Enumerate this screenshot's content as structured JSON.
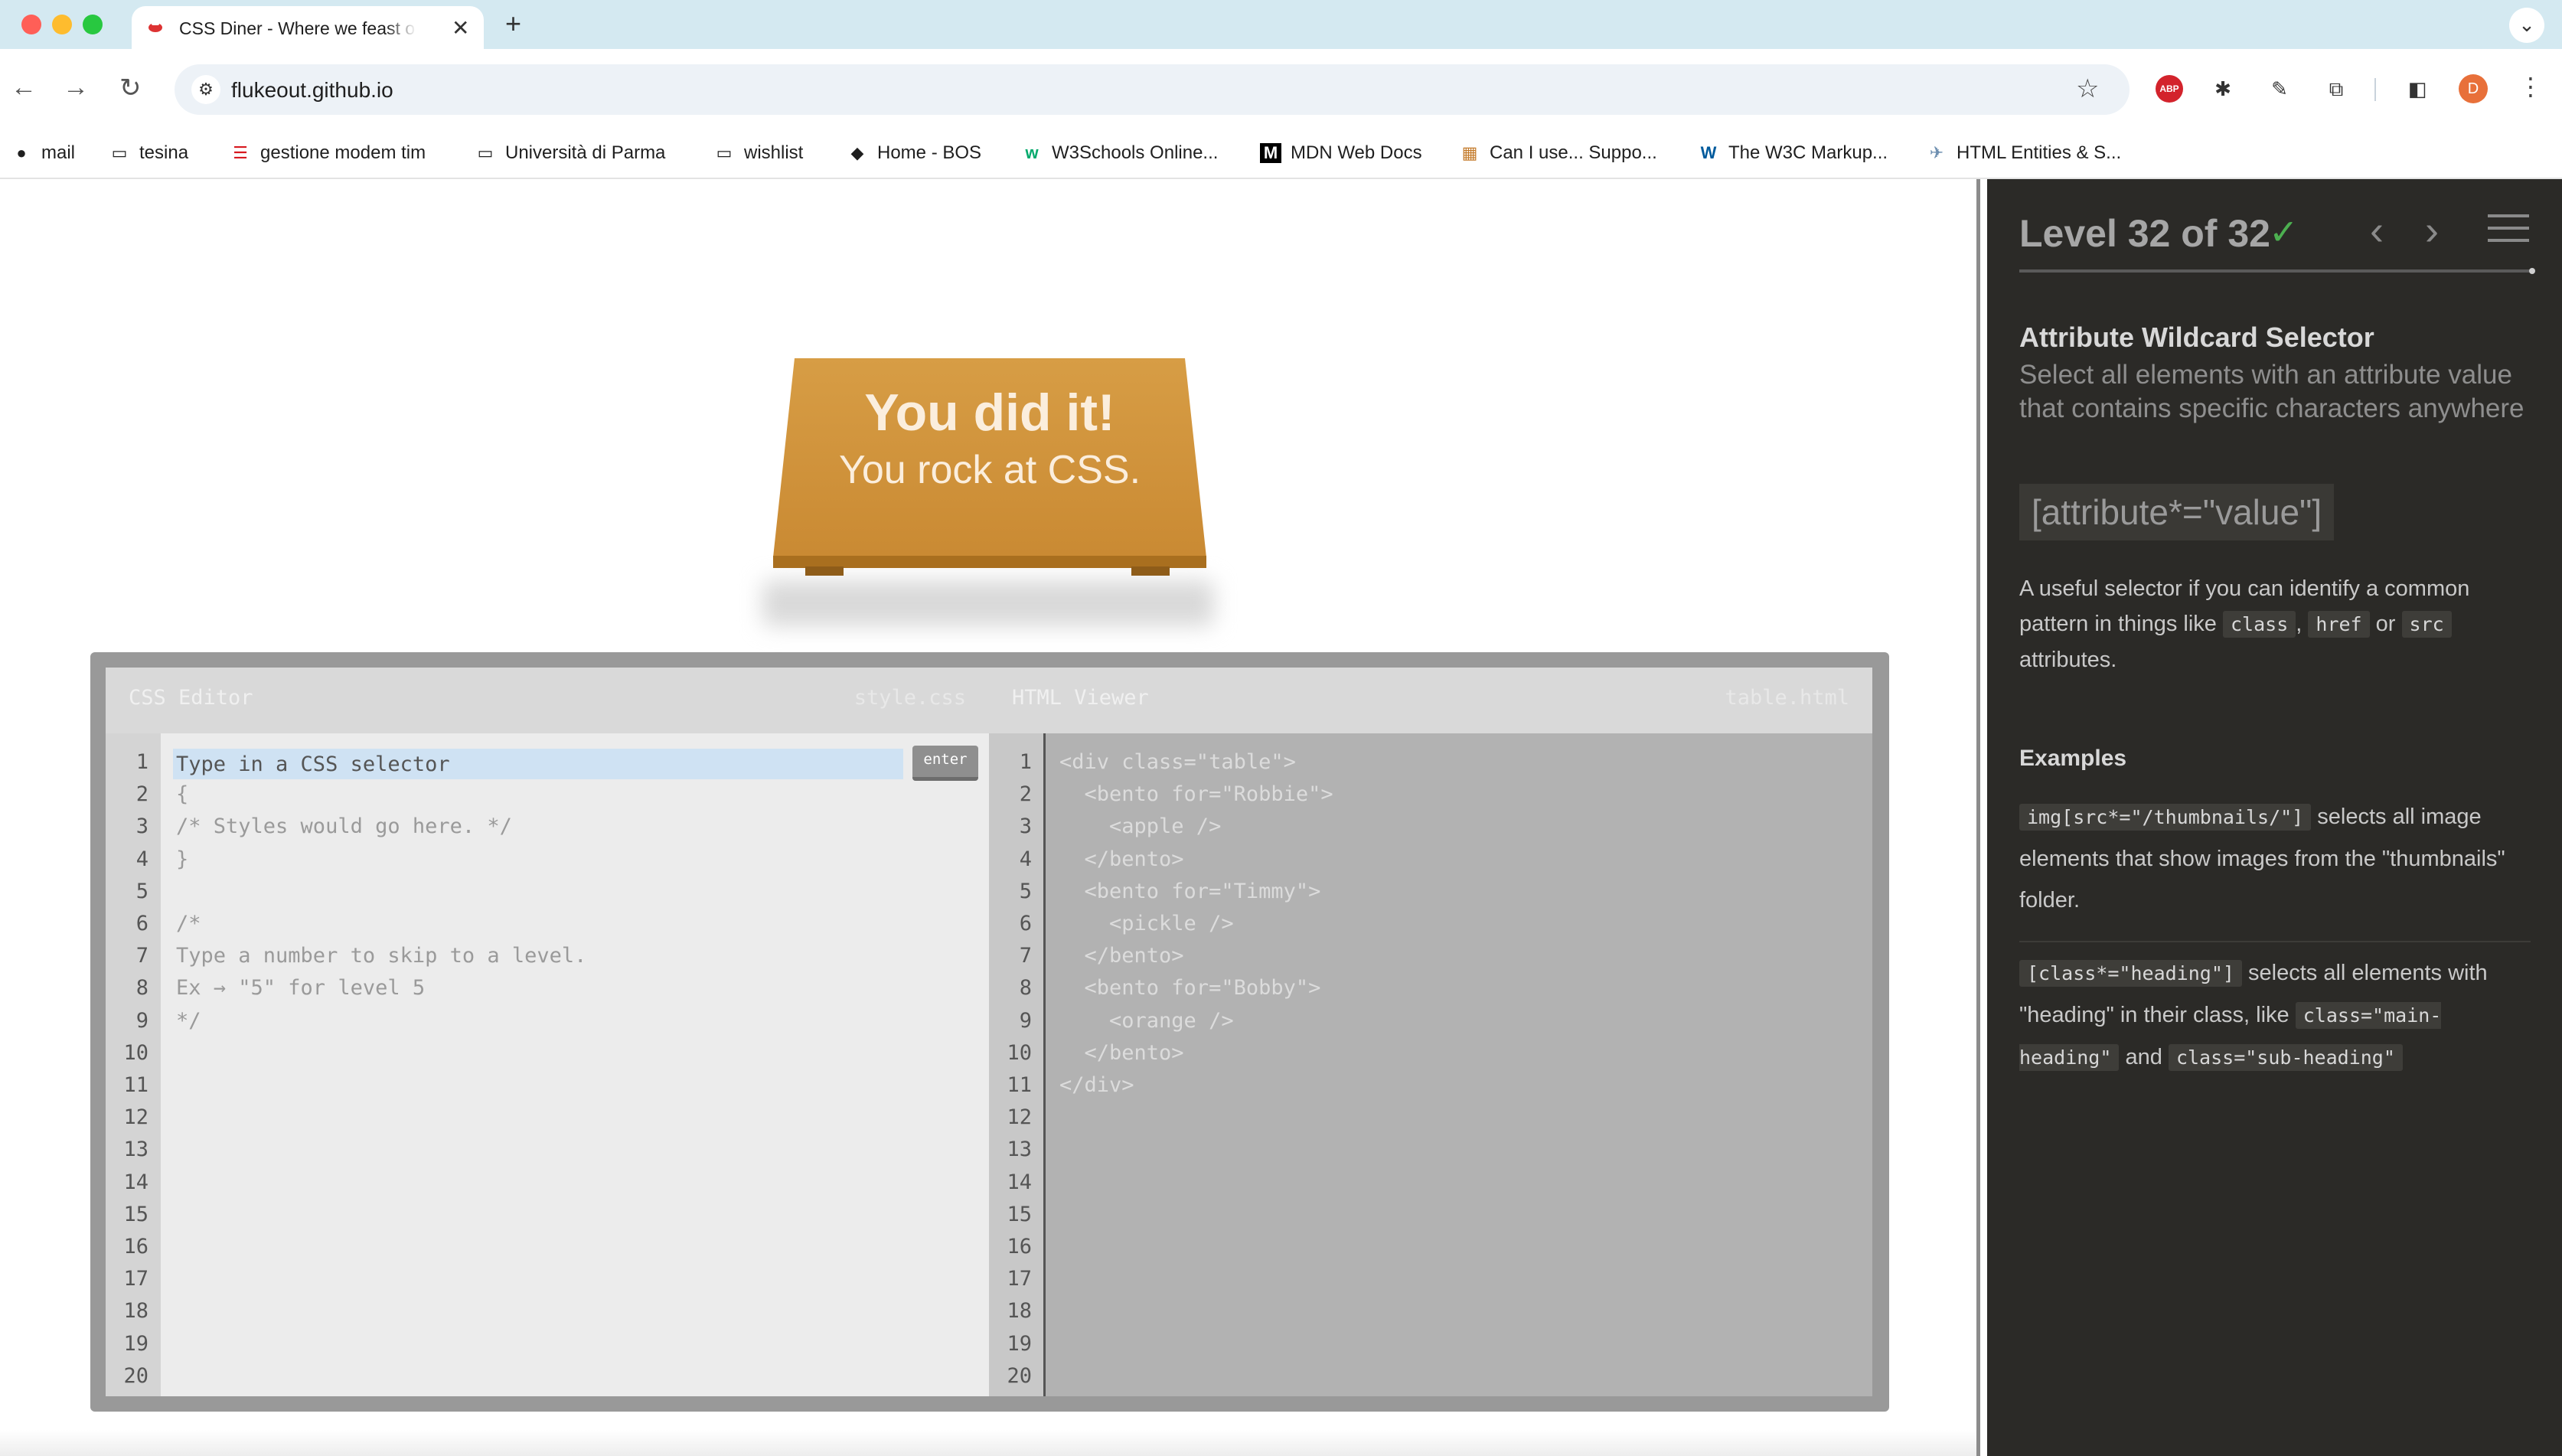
{
  "browser": {
    "tab_title": "CSS Diner - Where we feast on CSS",
    "url": "flukeout.github.io",
    "bookmarks": [
      {
        "label": "mail",
        "icon": "apple-icon"
      },
      {
        "label": "tesina",
        "icon": "folder-icon"
      },
      {
        "label": "gestione modem tim",
        "icon": "tim-icon"
      },
      {
        "label": "Università di Parma",
        "icon": "folder-icon"
      },
      {
        "label": "wishlist",
        "icon": "folder-icon"
      },
      {
        "label": "Home - BOS",
        "icon": "bos-icon"
      },
      {
        "label": "W3Schools Online...",
        "icon": "w3schools-icon"
      },
      {
        "label": "MDN Web Docs",
        "icon": "mdn-icon"
      },
      {
        "label": "Can I use... Suppo...",
        "icon": "caniuse-icon"
      },
      {
        "label": "The W3C Markup...",
        "icon": "w3c-icon"
      },
      {
        "label": "HTML Entities & S...",
        "icon": "html-entities-icon"
      }
    ],
    "avatar_letter": "D",
    "abp_label": "ABP"
  },
  "game": {
    "win_line1": "You did it!",
    "win_line2": "You rock at CSS."
  },
  "css_editor": {
    "title": "CSS Editor",
    "file": "style.css",
    "input_placeholder": "Type in a CSS selector",
    "enter_label": "enter",
    "code_lines": [
      "",
      "{",
      "/* Styles would go here. */",
      "}",
      "",
      "/*",
      "Type a number to skip to a level.",
      "Ex → \"5\" for level 5",
      "*/"
    ],
    "line_count": 20
  },
  "html_viewer": {
    "title": "HTML Viewer",
    "file": "table.html",
    "code_lines": [
      "<div class=\"table\">",
      "  <bento for=\"Robbie\">",
      "    <apple />",
      "  </bento>",
      "  <bento for=\"Timmy\">",
      "    <pickle />",
      "  </bento>",
      "  <bento for=\"Bobby\">",
      "    <orange />",
      "  </bento>",
      "</div>"
    ],
    "line_count": 20
  },
  "sidebar": {
    "level_text": "Level 32 of 32",
    "selector_name": "Attribute Wildcard Selector",
    "selector_title": "Select all elements with an attribute value that contains specific characters anywhere",
    "syntax": "[attribute*=\"value\"]",
    "hint_pre": "A useful selector if you can identify a common pattern in things like",
    "hint_code1": "class",
    "hint_sep1": ",",
    "hint_code2": "href",
    "hint_sep2": "or",
    "hint_code3": "src",
    "hint_post": "attributes.",
    "examples_title": "Examples",
    "ex1_code": "img[src*=\"/thumbnails/\"]",
    "ex1_text": "selects all image elements that show images from the \"thumbnails\" folder.",
    "ex2_code": "[class*=\"heading\"]",
    "ex2_text1": "selects all elements with \"heading\" in their class, like",
    "ex2_code2": "class=\"main-heading\"",
    "ex2_and": "and",
    "ex2_code3": "class=\"sub-heading\""
  },
  "colors": {
    "sidebar_bg": "#2b2a27",
    "table_wood": "#d79d45",
    "check_green": "#4caf50",
    "tab_bar": "#d4e9f1"
  }
}
